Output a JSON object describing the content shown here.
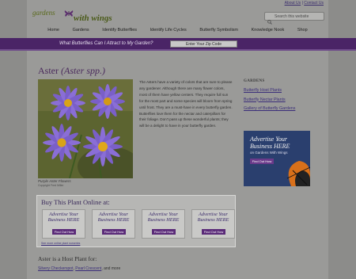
{
  "top_links": {
    "about": "About Us",
    "sep": "|",
    "contact": "Contact Us"
  },
  "logo": {
    "line1": "gardens",
    "line2": "with wings"
  },
  "search": {
    "placeholder": "Search this website"
  },
  "nav": [
    "Home",
    "Gardens",
    "Identify Butterflies",
    "Identify Life Cycles",
    "Butterfly Symbolism",
    "Knowledge Nook",
    "Shop"
  ],
  "banner": {
    "question": "What Butterflies Can I Attract to My Garden?",
    "zip_button": "Enter Your Zip Code"
  },
  "plant": {
    "title": "Aster",
    "title_latin": "(Aster spp.)",
    "caption": "Purple Aster Flowers",
    "copyright": "Copyright Fred Miller",
    "description": "The Asters have a variety of colors that are sure to please any gardener. Although there are many flower colors, most of them have yellow centers. They require full sun for the most part and some species will bloom from spring until frost. They are a must-have in every butterfly garden. Butterflies love them for the nectar and caterpillars for their foliage. Don't pass up these wonderful plants; they will be a delight to have in your butterfly garden."
  },
  "sidebar": {
    "heading": "GARDENS",
    "links": [
      "Butterfly Host Plants",
      "Butterfly Nectar Plants",
      "Gallery of Butterfly Gardens"
    ],
    "ad": {
      "line1": "Advertise Your",
      "line2": "Business HERE",
      "sub": "on Gardens With Wings",
      "button": "Find Out How"
    }
  },
  "buy": {
    "title": "Buy This Plant Online at:",
    "ads": [
      {
        "line1": "Advertise Your",
        "line2": "Business HERE",
        "button": "Find Out How"
      },
      {
        "line1": "Advertise Your",
        "line2": "Business HERE",
        "button": "Find Out How"
      },
      {
        "line1": "Advertise Your",
        "line2": "Business HERE",
        "button": "Find Out How"
      },
      {
        "line1": "Advertise Your",
        "line2": "Business HERE",
        "button": "Find Out How"
      }
    ],
    "more_link": "See more online plant nurseries"
  },
  "host": {
    "heading": "Aster is a Host Plant for:",
    "link1": "Silvery Checkerspot",
    "sep": ", ",
    "link2": "Pearl Crescent",
    "suffix": ", and more"
  },
  "colors": {
    "brand_purple": "#4a2466",
    "link": "#3b2e7a",
    "page_bg": "#9a9a98"
  }
}
